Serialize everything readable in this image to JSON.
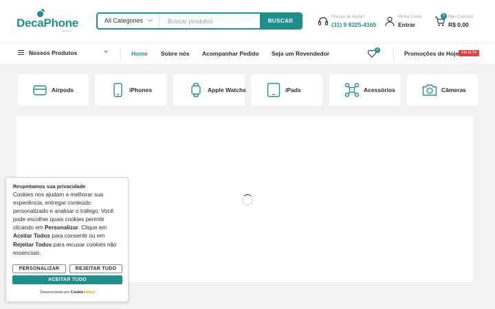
{
  "brand": {
    "name": "DecaPhone",
    "tagline": "Since 2011",
    "color": "#1e8f8c"
  },
  "search": {
    "category": "All Categories",
    "placeholder": "Buscar produtos",
    "button": "BUSCAR"
  },
  "help": {
    "label": "Precisa de Ajuda?",
    "phone": "(31) 9 8325-4165",
    "icon": "headset-icon"
  },
  "account": {
    "label": "Minha Conta",
    "action": "Entrar",
    "icon": "user-icon"
  },
  "cart": {
    "label": "Meu Carrinho",
    "total": "R$ 0,00",
    "count": "0",
    "icon": "cart-icon"
  },
  "nav": {
    "menu": "Nossos Produtos",
    "links": [
      "Home",
      "Sobre nós",
      "Acompanhar Pedido",
      "Seja um Revendedor"
    ],
    "wishlist_count": "0",
    "promo": "Promoções de Hoje",
    "promo_badge": "EM ALTA",
    "badge_color": "#e53d3d"
  },
  "categories": [
    {
      "label": "Airpods",
      "icon": "airpods-case-icon"
    },
    {
      "label": "iPhones",
      "icon": "phone-icon"
    },
    {
      "label": "Apple Watchs",
      "icon": "watch-icon"
    },
    {
      "label": "iPads",
      "icon": "tablet-icon"
    },
    {
      "label": "Acessórios",
      "icon": "accessories-icon"
    },
    {
      "label": "Câmeras",
      "icon": "camera-icon"
    }
  ],
  "cookie": {
    "title": "Respeitamos sua privacidade",
    "text_1": "Cookies nos ajudam a melhorar sua experiência, entregar conteúdo personalizado e analisar o tráfego. Você pode escolher quais cookies permitir clicando em ",
    "bold_1": "Personalizar",
    "text_2": ". Clique em ",
    "bold_2": "Aceitar Todos",
    "text_3": " para consentir ou em ",
    "bold_3": "Rejeitar Todos",
    "text_4": " para recusar cookies não essenciais.",
    "btn_personalize": "PERSONALIZAR",
    "btn_reject": "REJEITAR TUDO",
    "btn_accept": "ACEITAR TUDO",
    "footer": "Desenvolvido por",
    "footer_brand_1": "Cookie",
    "footer_brand_2": "Admin"
  }
}
